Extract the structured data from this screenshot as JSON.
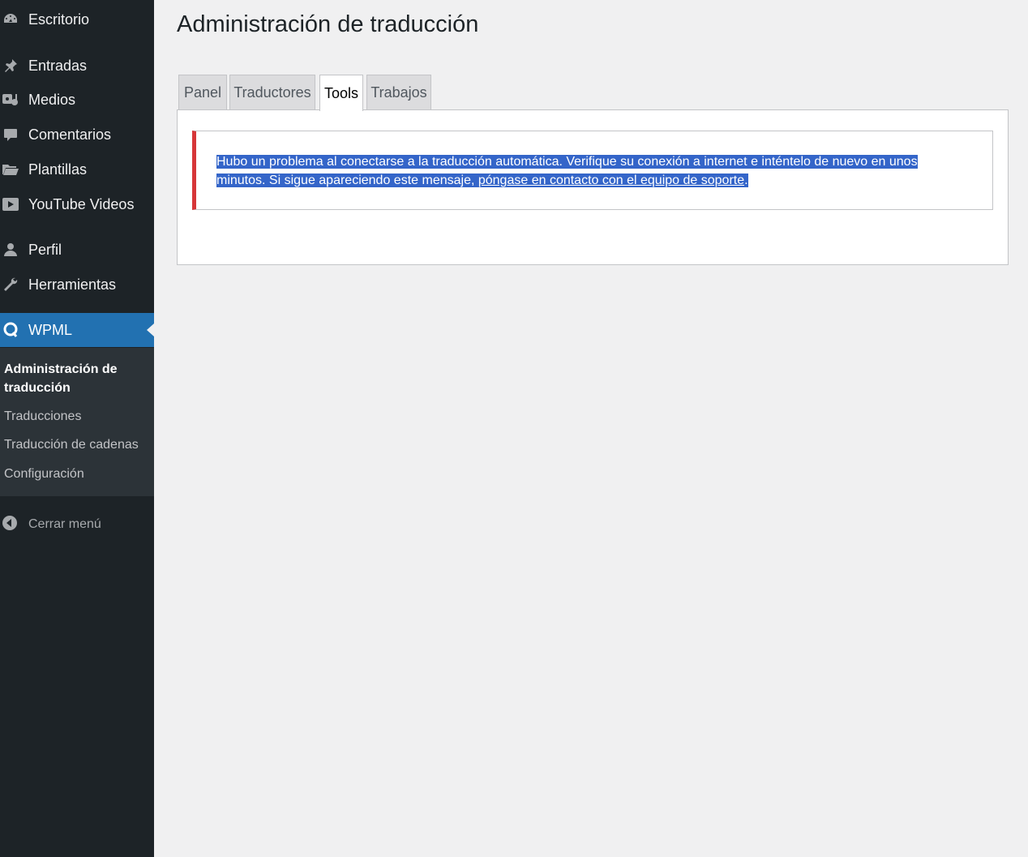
{
  "sidebar": {
    "items": [
      {
        "label": "Escritorio",
        "icon": "dashboard-icon"
      },
      {
        "label": "Entradas",
        "icon": "pushpin-icon"
      },
      {
        "label": "Medios",
        "icon": "media-icon"
      },
      {
        "label": "Comentarios",
        "icon": "comment-icon"
      },
      {
        "label": "Plantillas",
        "icon": "folder-icon"
      },
      {
        "label": "YouTube Videos",
        "icon": "video-icon"
      },
      {
        "label": "Perfil",
        "icon": "user-icon"
      },
      {
        "label": "Herramientas",
        "icon": "wrench-icon"
      },
      {
        "label": "WPML",
        "icon": "wpml-icon"
      }
    ],
    "submenu": [
      {
        "label": "Administración de traducción"
      },
      {
        "label": "Traducciones"
      },
      {
        "label": "Traducción de cadenas"
      },
      {
        "label": "Configuración"
      }
    ],
    "collapse_label": "Cerrar menú"
  },
  "main": {
    "title": "Administración de traducción",
    "tabs": [
      {
        "label": "Panel"
      },
      {
        "label": "Traductores"
      },
      {
        "label": "Tools"
      },
      {
        "label": "Trabajos"
      }
    ],
    "active_tab": "Tools",
    "notice": {
      "text_line1": "Hubo un problema al conectarse a la traducción automática. Verifique su conexión a internet e inténtelo de nuevo en unos",
      "text_line2": "minutos. Si sigue apareciendo este mensaje, ",
      "link": "póngase en contacto con el equipo de soporte",
      "text_end": "."
    }
  },
  "colors": {
    "sidebar_bg": "#1d2327",
    "active_menu": "#2271b1",
    "error_border": "#d63638",
    "selection": "#3465c9"
  }
}
